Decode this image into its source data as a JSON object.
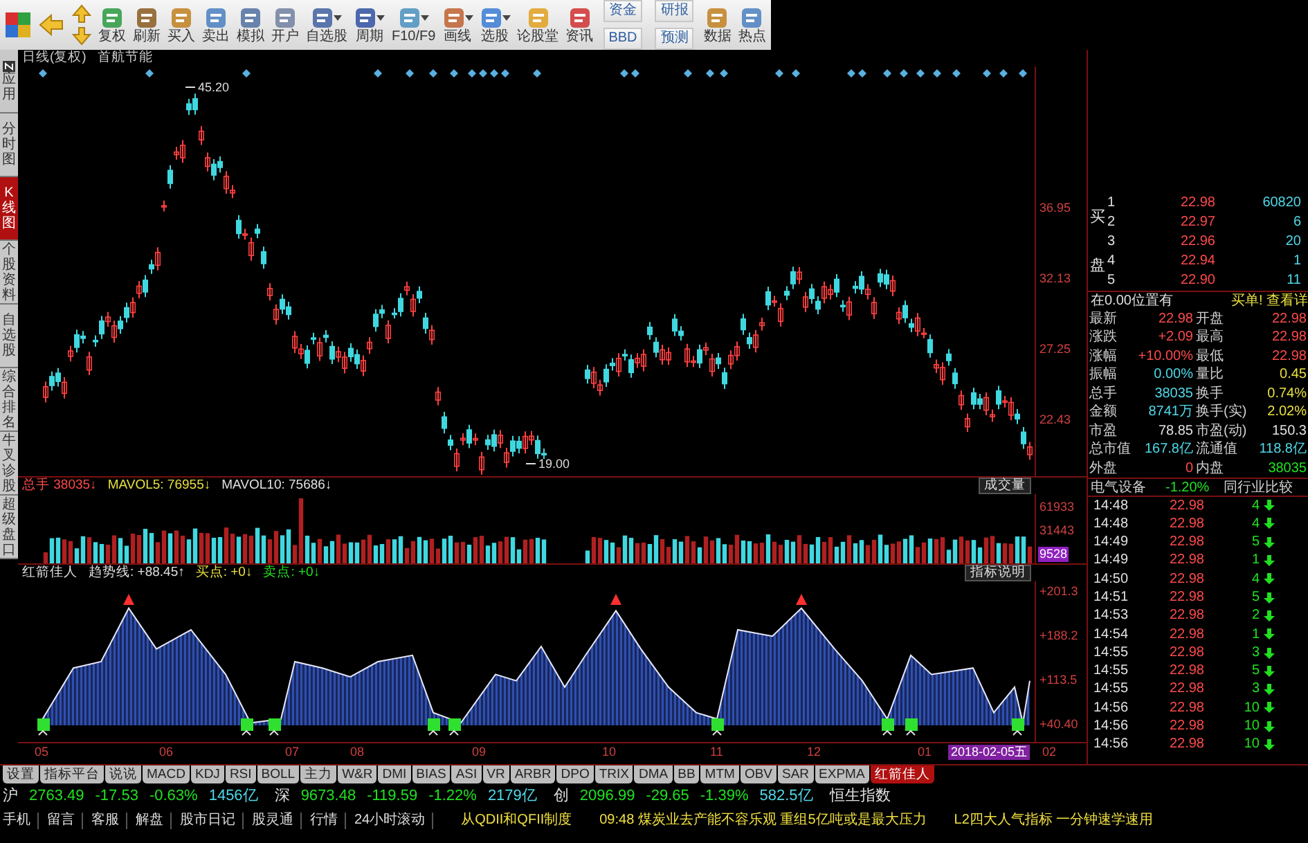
{
  "toolbar": [
    {
      "kind": "logo"
    },
    {
      "kind": "back"
    },
    {
      "kind": "updown"
    },
    {
      "kind": "tool",
      "label": "复权",
      "menu": false
    },
    {
      "kind": "tool",
      "label": "刷新",
      "menu": false
    },
    {
      "kind": "tool",
      "label": "买入",
      "menu": false
    },
    {
      "kind": "tool",
      "label": "卖出",
      "menu": false
    },
    {
      "kind": "tool",
      "label": "模拟",
      "menu": false
    },
    {
      "kind": "tool",
      "label": "开户",
      "menu": false
    },
    {
      "kind": "tool",
      "label": "自选股",
      "menu": true
    },
    {
      "kind": "tool",
      "label": "周期",
      "menu": true
    },
    {
      "kind": "tool",
      "label": "F10/F9",
      "menu": true
    },
    {
      "kind": "tool",
      "label": "画线",
      "menu": true
    },
    {
      "kind": "tool",
      "label": "选股",
      "menu": true
    },
    {
      "kind": "tool",
      "label": "论股堂",
      "menu": false
    },
    {
      "kind": "tool",
      "label": "资讯",
      "menu": false
    },
    {
      "kind": "pair",
      "labels": [
        "资金",
        "BBD"
      ]
    },
    {
      "kind": "pair",
      "labels": [
        "研报",
        "预测"
      ]
    },
    {
      "kind": "tool",
      "label": "数据",
      "menu": false
    },
    {
      "kind": "tool",
      "label": "热点",
      "menu": false
    }
  ],
  "sidebar": {
    "items": [
      {
        "kind": "app",
        "label": "应用",
        "selected": false
      },
      {
        "kind": "tab",
        "label": "分时图",
        "selected": false
      },
      {
        "kind": "tab",
        "label": "K线图",
        "selected": true
      },
      {
        "kind": "tab",
        "label": "个股资料",
        "selected": false
      },
      {
        "kind": "tab",
        "label": "自选股",
        "selected": false
      },
      {
        "kind": "tab",
        "label": "综合排名",
        "selected": false
      },
      {
        "kind": "tab",
        "label": "牛叉诊股",
        "selected": false
      },
      {
        "kind": "tab",
        "label": "超级盘口",
        "selected": false
      }
    ]
  },
  "chart": {
    "period": "日线(复权)",
    "stock": "首航节能",
    "high_label": "45.20",
    "low_label": "19.00",
    "price_axis": [
      "36.95",
      "32.13",
      "27.25",
      "22.43"
    ]
  },
  "volume": {
    "label": "总手",
    "value": "38035↓",
    "ma5": "MAVOL5: 76955↓",
    "ma10": "MAVOL10: 75686↓",
    "button": "成交量",
    "axis": [
      "61933",
      "31443",
      "9528"
    ]
  },
  "indicator": {
    "name": "红箭佳人",
    "trend": "趋势线: +88.45↑",
    "buy": "买点: +0↓",
    "sell": "卖点: +0↓",
    "button": "指标说明",
    "axis": [
      "+201.3",
      "+188.2",
      "+113.5",
      "+40.40"
    ]
  },
  "date_axis": {
    "months": [
      "05",
      "06",
      "07",
      "08",
      "09",
      "10",
      "11",
      "12",
      "01"
    ],
    "cursor_date": "2018-02-05五",
    "last": "02"
  },
  "indicator_tabs": [
    {
      "label": "设置",
      "selected": false
    },
    {
      "label": "指标平台",
      "selected": false
    },
    {
      "label": "说说",
      "selected": false
    },
    {
      "label": "MACD",
      "selected": false
    },
    {
      "label": "KDJ",
      "selected": false
    },
    {
      "label": "RSI",
      "selected": false
    },
    {
      "label": "BOLL",
      "selected": false
    },
    {
      "label": "主力",
      "selected": false
    },
    {
      "label": "W&R",
      "selected": false
    },
    {
      "label": "DMI",
      "selected": false
    },
    {
      "label": "BIAS",
      "selected": false
    },
    {
      "label": "ASI",
      "selected": false
    },
    {
      "label": "VR",
      "selected": false
    },
    {
      "label": "ARBR",
      "selected": false
    },
    {
      "label": "DPO",
      "selected": false
    },
    {
      "label": "TRIX",
      "selected": false
    },
    {
      "label": "DMA",
      "selected": false
    },
    {
      "label": "BB",
      "selected": false
    },
    {
      "label": "MTM",
      "selected": false
    },
    {
      "label": "OBV",
      "selected": false
    },
    {
      "label": "SAR",
      "selected": false
    },
    {
      "label": "EXPMA",
      "selected": false
    },
    {
      "label": "红箭佳人",
      "selected": true
    }
  ],
  "index_bar": {
    "markets": [
      {
        "name": "沪",
        "price": "2763.49",
        "change": "-17.53",
        "percent": "-0.63%",
        "amount": "1456亿",
        "color": "#20e020"
      },
      {
        "name": "深",
        "price": "9673.48",
        "change": "-119.59",
        "percent": "-1.22%",
        "amount": "2179亿",
        "color": "#20e020"
      },
      {
        "name": "创",
        "price": "2096.99",
        "change": "-29.65",
        "percent": "-1.39%",
        "amount": "582.5亿",
        "color": "#20e020"
      }
    ],
    "trailing": "恒生指数"
  },
  "bottom_bar": {
    "links": [
      "手机",
      "留言",
      "客服",
      "解盘",
      "股市日记",
      "股灵通",
      "行情",
      "24小时滚动"
    ],
    "news": [
      "从QDII和QFII制度",
      "09:48 煤炭业去产能不容乐观 重组5亿吨或是最大压力",
      "L2四大人气指标 一分钟速学速用"
    ]
  },
  "quote": {
    "side_label": "买盘",
    "order_book": [
      {
        "level": "1",
        "price": "22.98",
        "volume": "60820"
      },
      {
        "level": "2",
        "price": "22.97",
        "volume": "6"
      },
      {
        "level": "3",
        "price": "22.96",
        "volume": "20"
      },
      {
        "level": "4",
        "price": "22.94",
        "volume": "1"
      },
      {
        "level": "5",
        "price": "22.90",
        "volume": "11"
      }
    ],
    "notice": "在0.00位置有",
    "notice_link": "买单! 查看详",
    "stats": [
      {
        "label": "最新",
        "value": "22.98",
        "color": "#ff4a4a"
      },
      {
        "label": "开盘",
        "value": "22.98",
        "color": "#ff4a4a"
      },
      {
        "label": "涨跌",
        "value": "+2.09",
        "color": "#ff4a4a"
      },
      {
        "label": "最高",
        "value": "22.98",
        "color": "#ff4a4a"
      },
      {
        "label": "涨幅",
        "value": "+10.00%",
        "color": "#ff4a4a"
      },
      {
        "label": "最低",
        "value": "22.98",
        "color": "#ff4a4a"
      },
      {
        "label": "振幅",
        "value": "0.00%",
        "color": "#4fd8e8"
      },
      {
        "label": "量比",
        "value": "0.45",
        "color": "#e8e040"
      },
      {
        "label": "总手",
        "value": "38035",
        "color": "#4fd8e8"
      },
      {
        "label": "换手",
        "value": "0.74%",
        "color": "#e8e040"
      },
      {
        "label": "金额",
        "value": "8741万",
        "color": "#4fd8e8"
      },
      {
        "label": "换手(实)",
        "value": "2.02%",
        "color": "#e8e040"
      },
      {
        "label": "市盈",
        "value": "78.85",
        "color": "#e0e0e0"
      },
      {
        "label": "市盈(动)",
        "value": "150.3",
        "color": "#e0e0e0"
      },
      {
        "label": "总市值",
        "value": "167.8亿",
        "color": "#4fd8e8"
      },
      {
        "label": "流通值",
        "value": "118.8亿",
        "color": "#4fd8e8"
      },
      {
        "label": "外盘",
        "value": "0",
        "color": "#ff4a4a"
      },
      {
        "label": "内盘",
        "value": "38035",
        "color": "#20e020"
      }
    ],
    "industry": {
      "name": "电气设备",
      "change": "-1.20%",
      "link": "同行业比较"
    },
    "ticks": [
      {
        "time": "14:48",
        "price": "22.98",
        "volume": "4",
        "falling": true
      },
      {
        "time": "14:48",
        "price": "22.98",
        "volume": "4",
        "falling": true
      },
      {
        "time": "14:49",
        "price": "22.98",
        "volume": "5",
        "falling": true
      },
      {
        "time": "14:49",
        "price": "22.98",
        "volume": "1",
        "falling": true
      },
      {
        "time": "14:50",
        "price": "22.98",
        "volume": "4",
        "falling": true
      },
      {
        "time": "14:51",
        "price": "22.98",
        "volume": "5",
        "falling": true
      },
      {
        "time": "14:53",
        "price": "22.98",
        "volume": "2",
        "falling": true
      },
      {
        "time": "14:54",
        "price": "22.98",
        "volume": "1",
        "falling": true
      },
      {
        "time": "14:55",
        "price": "22.98",
        "volume": "3",
        "falling": true
      },
      {
        "time": "14:55",
        "price": "22.98",
        "volume": "5",
        "falling": true
      },
      {
        "time": "14:55",
        "price": "22.98",
        "volume": "3",
        "falling": true
      },
      {
        "time": "14:56",
        "price": "22.98",
        "volume": "10",
        "falling": true
      },
      {
        "time": "14:56",
        "price": "22.98",
        "volume": "10",
        "falling": true
      },
      {
        "time": "14:56",
        "price": "22.98",
        "volume": "10",
        "falling": true
      }
    ]
  }
}
